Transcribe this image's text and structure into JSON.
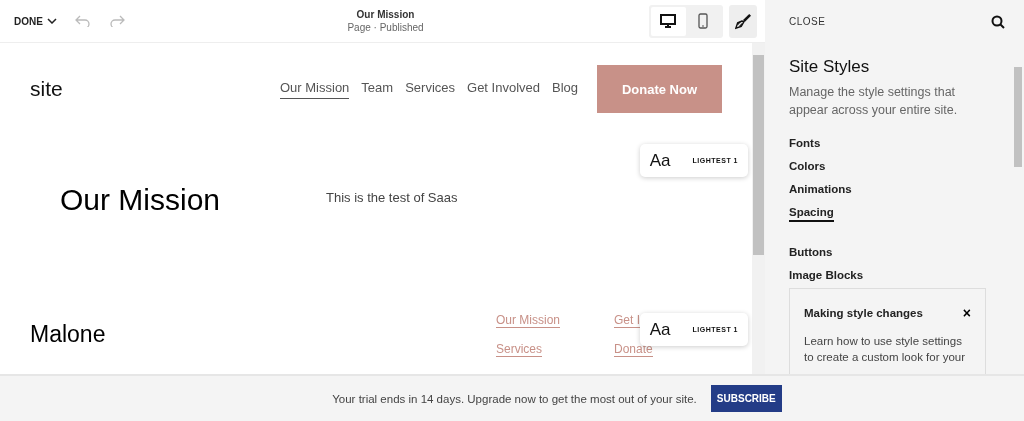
{
  "toolbar": {
    "done": "DONE",
    "page_title": "Our Mission",
    "page_status": "Page · Published",
    "views": [
      {
        "kind": "desktop",
        "selected": true
      },
      {
        "kind": "mobile",
        "selected": false
      }
    ]
  },
  "site": {
    "logo": "site",
    "nav": [
      {
        "label": "Our Mission",
        "selected": true
      },
      {
        "label": "Team",
        "selected": false
      },
      {
        "label": "Services",
        "selected": false
      },
      {
        "label": "Get Involved",
        "selected": false
      },
      {
        "label": "Blog",
        "selected": false
      }
    ],
    "cta": "Donate Now",
    "heading": "Our Mission",
    "body": "This is the test of Saas",
    "footer_title": "Malone",
    "footer_links": [
      [
        "Our Mission",
        "Services"
      ],
      [
        "Get I",
        "Donate"
      ]
    ],
    "font_chips": [
      {
        "sample": "Aa",
        "label": "LIGHTEST 1"
      },
      {
        "sample": "Aa",
        "label": "LIGHTEST 1"
      }
    ]
  },
  "panel": {
    "close": "CLOSE",
    "title": "Site Styles",
    "description": "Manage the style settings that appear across your entire site.",
    "groups": [
      [
        {
          "label": "Fonts",
          "selected": false
        },
        {
          "label": "Colors",
          "selected": false
        },
        {
          "label": "Animations",
          "selected": false
        },
        {
          "label": "Spacing",
          "selected": true
        }
      ],
      [
        {
          "label": "Buttons",
          "selected": false
        },
        {
          "label": "Image Blocks",
          "selected": false
        }
      ]
    ],
    "tip": {
      "title": "Making style changes",
      "close": "×",
      "text": "Learn how to use style settings to create a custom look for your"
    }
  },
  "banner": {
    "text": "Your trial ends in 14 days. Upgrade now to get the most out of your site.",
    "button": "SUBSCRIBE"
  }
}
